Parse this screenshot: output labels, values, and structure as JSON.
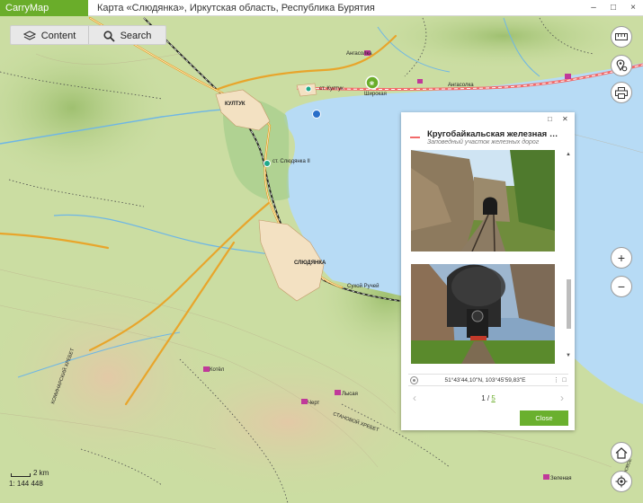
{
  "app": {
    "name": "CarryMap",
    "window_title": "Карта «Слюдянка», Иркутская область, Республика Бурятия",
    "window_controls": [
      "–",
      "□",
      "×"
    ]
  },
  "toolbar": {
    "content_label": "Content",
    "search_label": "Search"
  },
  "map": {
    "colors": {
      "water": "#b9dcf5",
      "land": "#cde0a6",
      "road": "#e8a52b",
      "railway": "#222222",
      "railway_highlight": "#f26a6a",
      "accent": "#6aad2a"
    },
    "labels": {
      "angasolka": "Ангасолка",
      "ang_station": "Ангасолка",
      "kultuk_station": "ст. Култук",
      "shirokaya": "Широкая",
      "kultuk": "КУЛТУК",
      "slyudyanka2": "ст. Слюдянка II",
      "slyudyanka": "СЛЮДЯНКА",
      "sukhoy": "Сухой Ручей",
      "kotyolnaya": "Котёл",
      "kommunar": "КОМИНАРСКИЙ ХРЕБЕТ",
      "chert": "Черт",
      "lysaya": "Лысая",
      "stanovoy": "СТАНОВОЙ ХРЕБЕТ",
      "zelenaya": "Зеленая",
      "ridge_e": "ХР. СТАНОВОЕ"
    },
    "scale_text": "2 km",
    "scale_ratio": "1: 144 448"
  },
  "right_controls": {
    "measure_icon": "ruler-icon",
    "locate_icon": "pin-gear-icon",
    "print_icon": "print-icon",
    "zoom_in": "+",
    "zoom_out": "−",
    "home_icon": "home-icon",
    "gps_icon": "gps-icon"
  },
  "popup": {
    "title": "Кругобайкальская железная дорога",
    "subtitle": "Заповедный участок железных дорог",
    "coordinates": "51°43'44,10\"N, 103°45'59,83\"E",
    "current_page": "1 /",
    "total_pages": "5",
    "close_label": "Close",
    "restore_glyph": "□",
    "close_glyph": "✕",
    "photos": [
      "tunnel-photo",
      "steam-train-photo"
    ]
  }
}
